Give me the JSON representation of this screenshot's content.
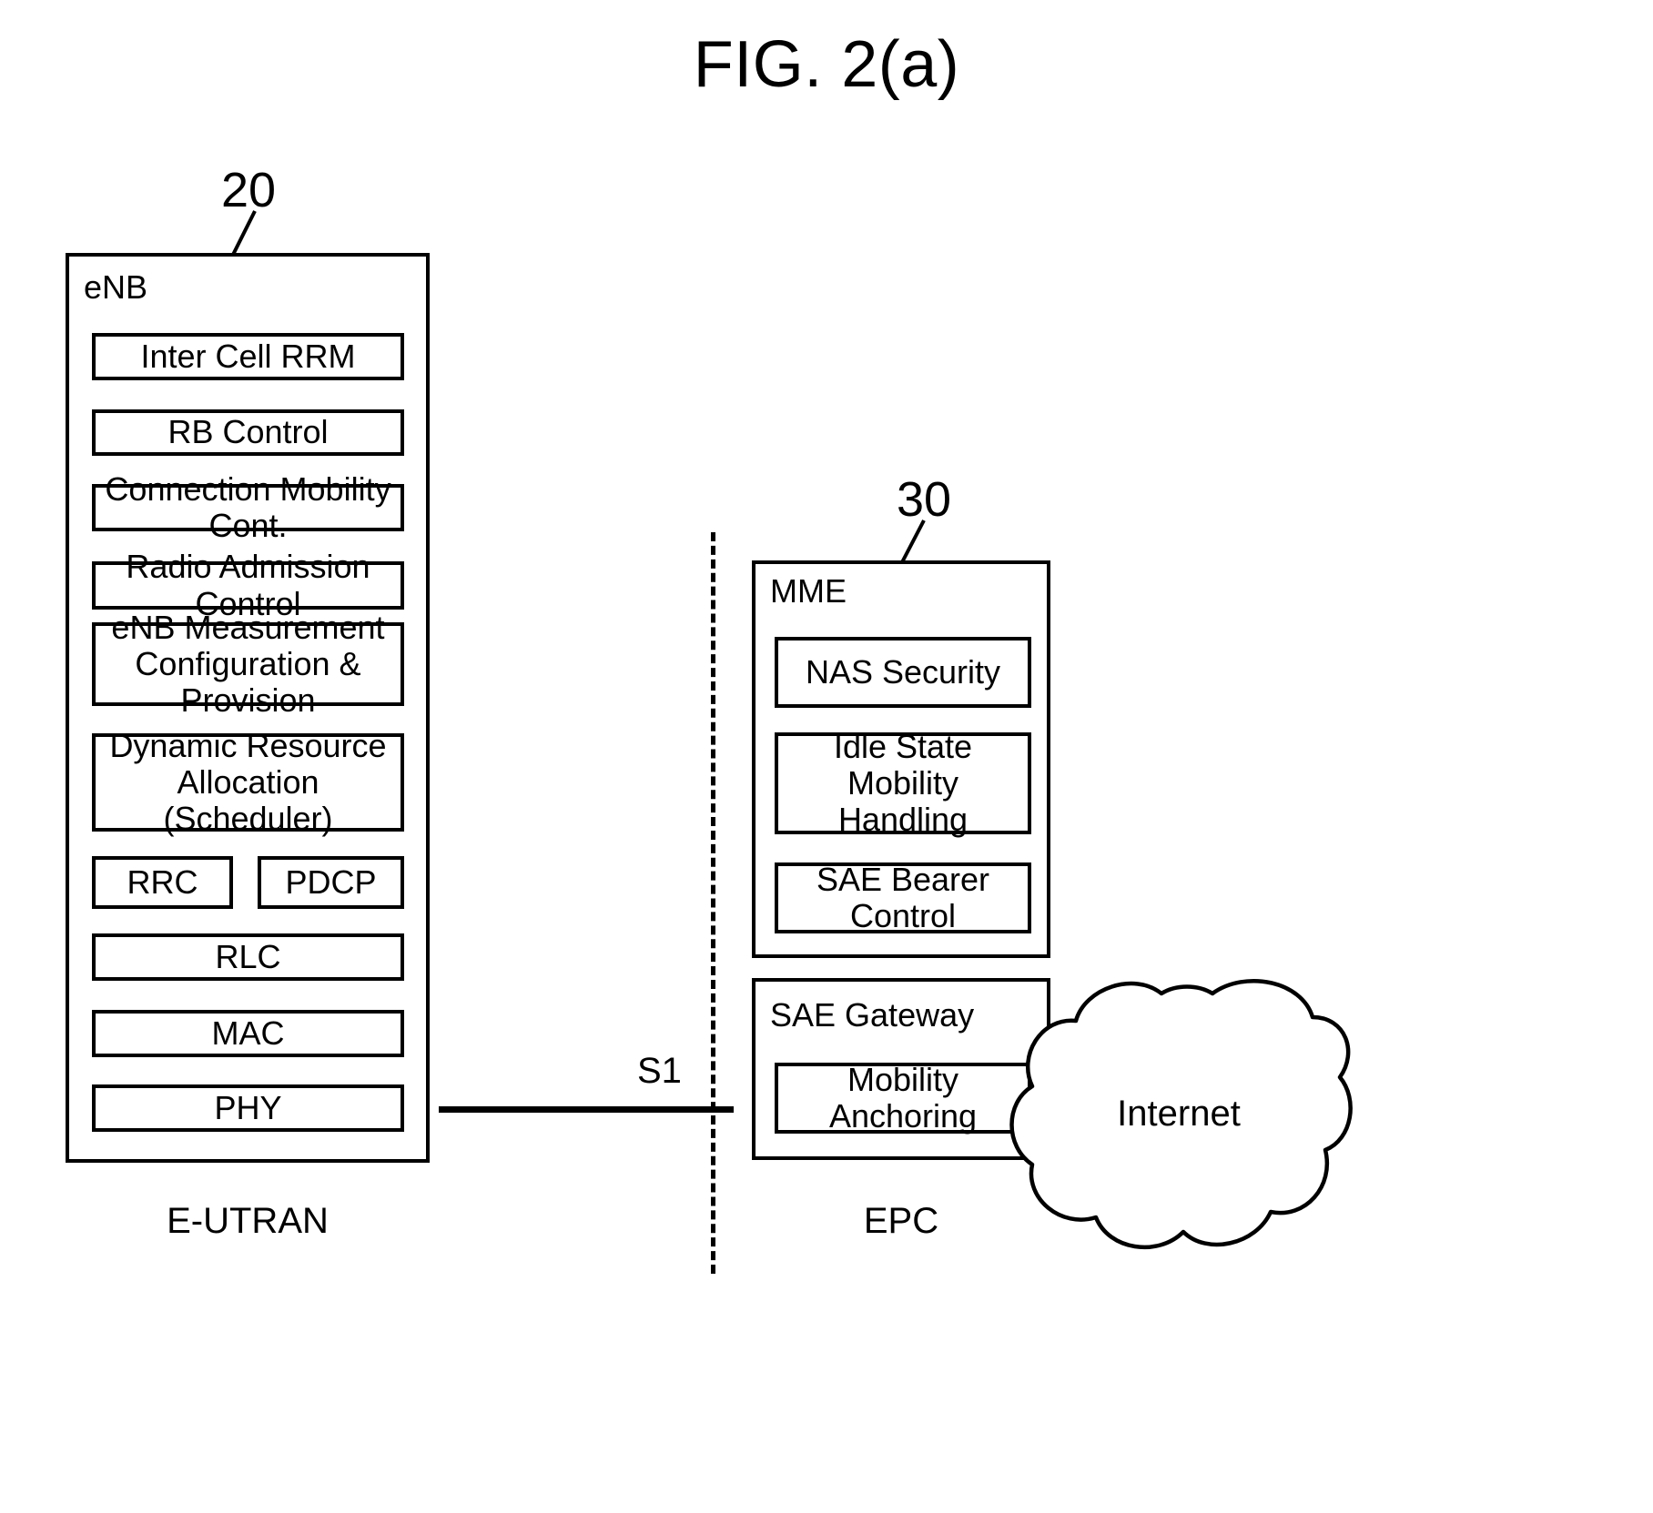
{
  "figure": {
    "title": "FIG. 2(a)"
  },
  "reference_numerals": {
    "enb": "20",
    "mme": "30"
  },
  "enb": {
    "title": "eNB",
    "domain_label": "E-UTRAN",
    "modules": [
      {
        "label": "Inter Cell RRM"
      },
      {
        "label": "RB  Control"
      },
      {
        "label": "Connection Mobility Cont."
      },
      {
        "label": "Radio Admission Control"
      },
      {
        "label": "eNB Measurement\nConfiguration & Provision"
      },
      {
        "label": "Dynamic Resource\nAllocation (Scheduler)"
      },
      {
        "label": "RRC"
      },
      {
        "label": "PDCP"
      },
      {
        "label": "RLC"
      },
      {
        "label": "MAC"
      },
      {
        "label": "PHY"
      }
    ]
  },
  "interface": {
    "name": "S1"
  },
  "mme": {
    "title": "MME",
    "modules": [
      {
        "label": "NAS  Security"
      },
      {
        "label": "Idle State Mobility\nHandling"
      },
      {
        "label": "SAE Bearer Control"
      }
    ]
  },
  "sae_gateway": {
    "title": "SAE Gateway",
    "modules": [
      {
        "label": "Mobility Anchoring"
      }
    ]
  },
  "epc": {
    "domain_label": "EPC"
  },
  "internet": {
    "label": "Internet"
  },
  "colors": {
    "stroke": "#000000",
    "background": "#ffffff"
  }
}
